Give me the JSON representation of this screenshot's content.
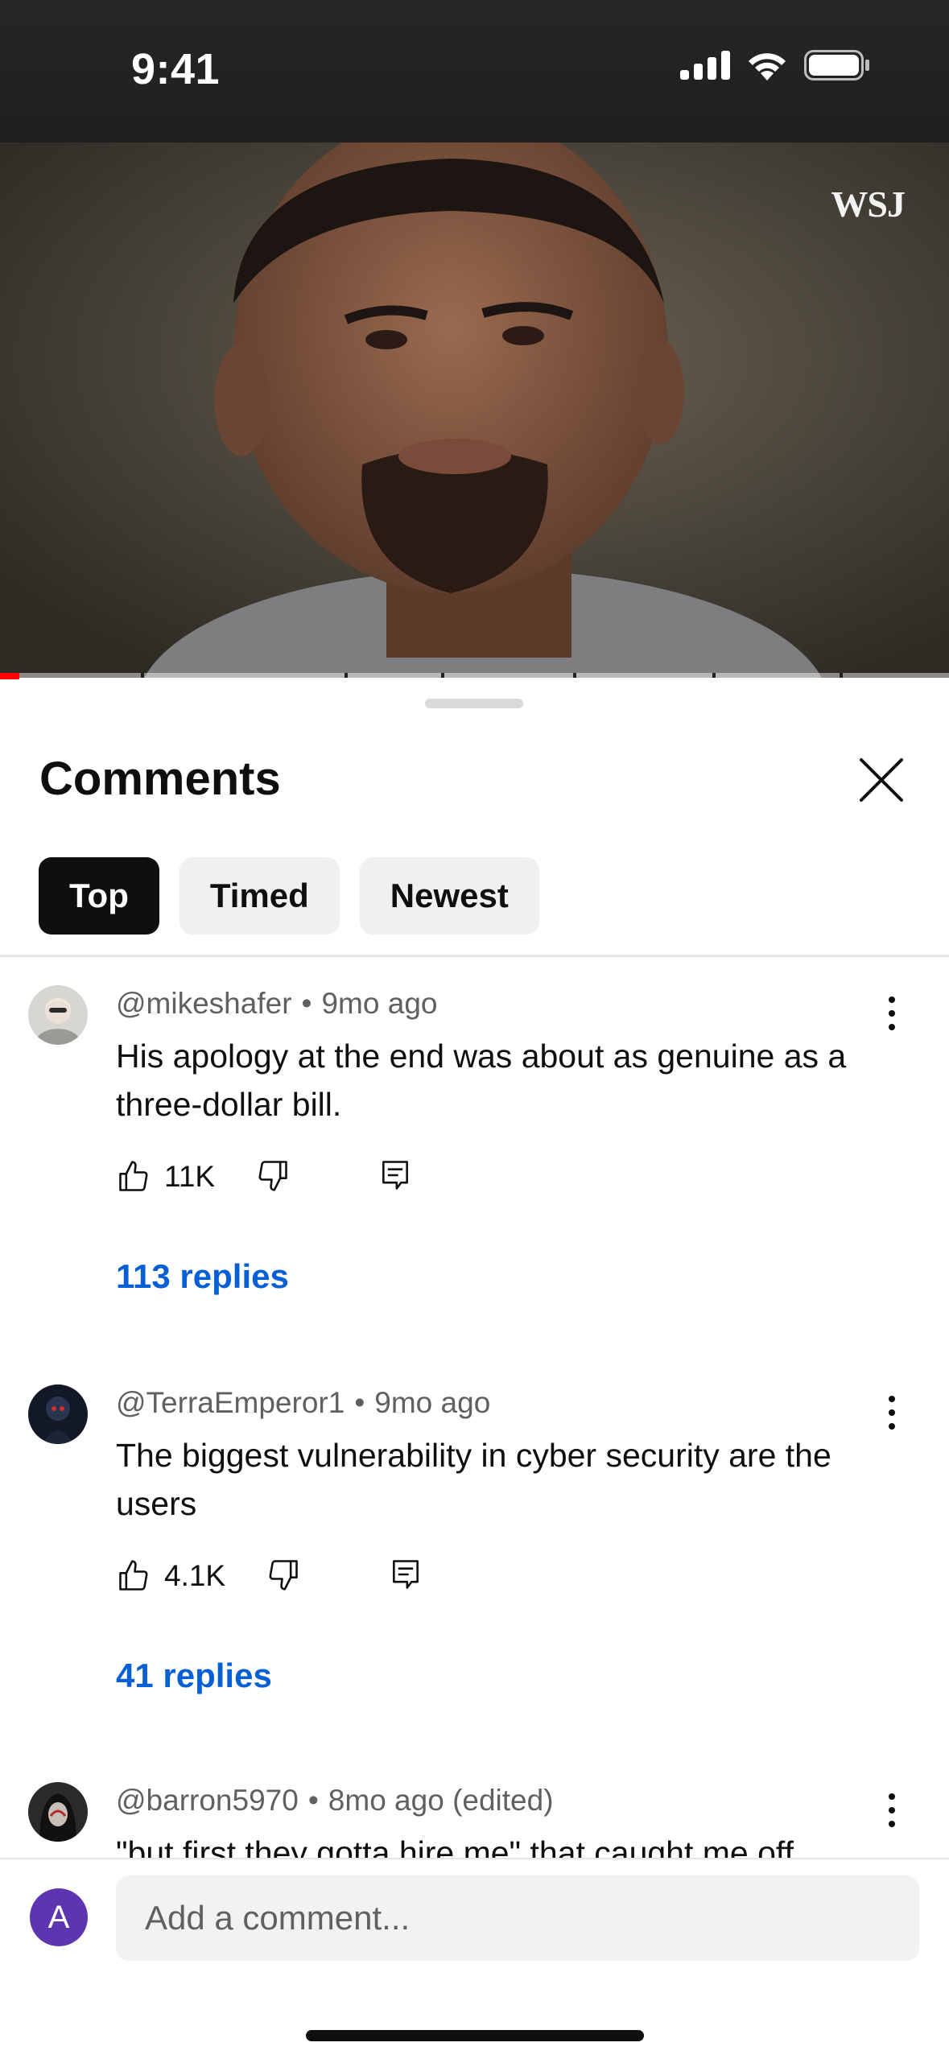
{
  "status_bar": {
    "time": "9:41"
  },
  "video": {
    "watermark": "WSJ",
    "progress_fraction": 0.02
  },
  "comments_panel": {
    "title": "Comments",
    "tabs": [
      {
        "label": "Top",
        "active": true
      },
      {
        "label": "Timed",
        "active": false
      },
      {
        "label": "Newest",
        "active": false
      }
    ],
    "comments": [
      {
        "author": "@mikeshafer",
        "age": "9mo ago",
        "text": "His apology at the end was about as genuine as a three-dollar bill.",
        "likes": "11K",
        "replies": "113 replies"
      },
      {
        "author": "@TerraEmperor1",
        "age": "9mo ago",
        "text": "The biggest vulnerability in cyber security are the users",
        "likes": "4.1K",
        "replies": "41 replies"
      },
      {
        "author": "@barron5970",
        "age": "8mo ago (edited)",
        "text": "\"but first they gotta hire me\" that caught me off"
      }
    ]
  },
  "composer": {
    "avatar_letter": "A",
    "placeholder": "Add a comment..."
  },
  "colors": {
    "accent_blue": "#065fd4",
    "avatar_purple": "#5e35b1",
    "progress_red": "#ff0000"
  }
}
